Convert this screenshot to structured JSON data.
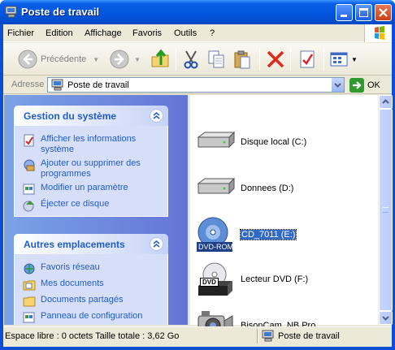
{
  "window": {
    "title": "Poste de travail"
  },
  "menu": {
    "items": [
      {
        "label": "Fichier"
      },
      {
        "label": "Edition"
      },
      {
        "label": "Affichage"
      },
      {
        "label": "Favoris"
      },
      {
        "label": "Outils"
      },
      {
        "label": "?"
      }
    ]
  },
  "toolbar": {
    "back_label": "Précédente"
  },
  "address": {
    "label": "Adresse",
    "value": "Poste de travail",
    "go_label": "OK"
  },
  "panels": {
    "system": {
      "title": "Gestion du système",
      "tasks": [
        {
          "label": "Afficher les informations système"
        },
        {
          "label": "Ajouter ou supprimer des programmes"
        },
        {
          "label": "Modifier un paramètre"
        },
        {
          "label": "Éjecter ce disque"
        }
      ]
    },
    "places": {
      "title": "Autres emplacements",
      "tasks": [
        {
          "label": "Favoris réseau"
        },
        {
          "label": "Mes documents"
        },
        {
          "label": "Documents partagés"
        },
        {
          "label": "Panneau de configuration"
        }
      ]
    }
  },
  "drives": [
    {
      "label": "Disque local (C:)",
      "icon": "hard-drive-icon"
    },
    {
      "label": "Donnees (D:)",
      "icon": "hard-drive-icon"
    },
    {
      "label": "CD_7011 (E:)",
      "icon": "dvd-rom-icon",
      "overlay": "DVD-ROM",
      "selected": true
    },
    {
      "label": "Lecteur DVD (F:)",
      "icon": "dvd-drive-icon",
      "overlay": "DVD"
    },
    {
      "label": "BisonCam, NB Pro",
      "icon": "webcam-icon"
    }
  ],
  "status": {
    "left": "Espace libre : 0 octets Taille totale : 3,62 Go",
    "right": "Poste de travail"
  },
  "colors": {
    "title_bar": "#0455de",
    "task_link": "#215dc6",
    "selection": "#316ac5"
  }
}
